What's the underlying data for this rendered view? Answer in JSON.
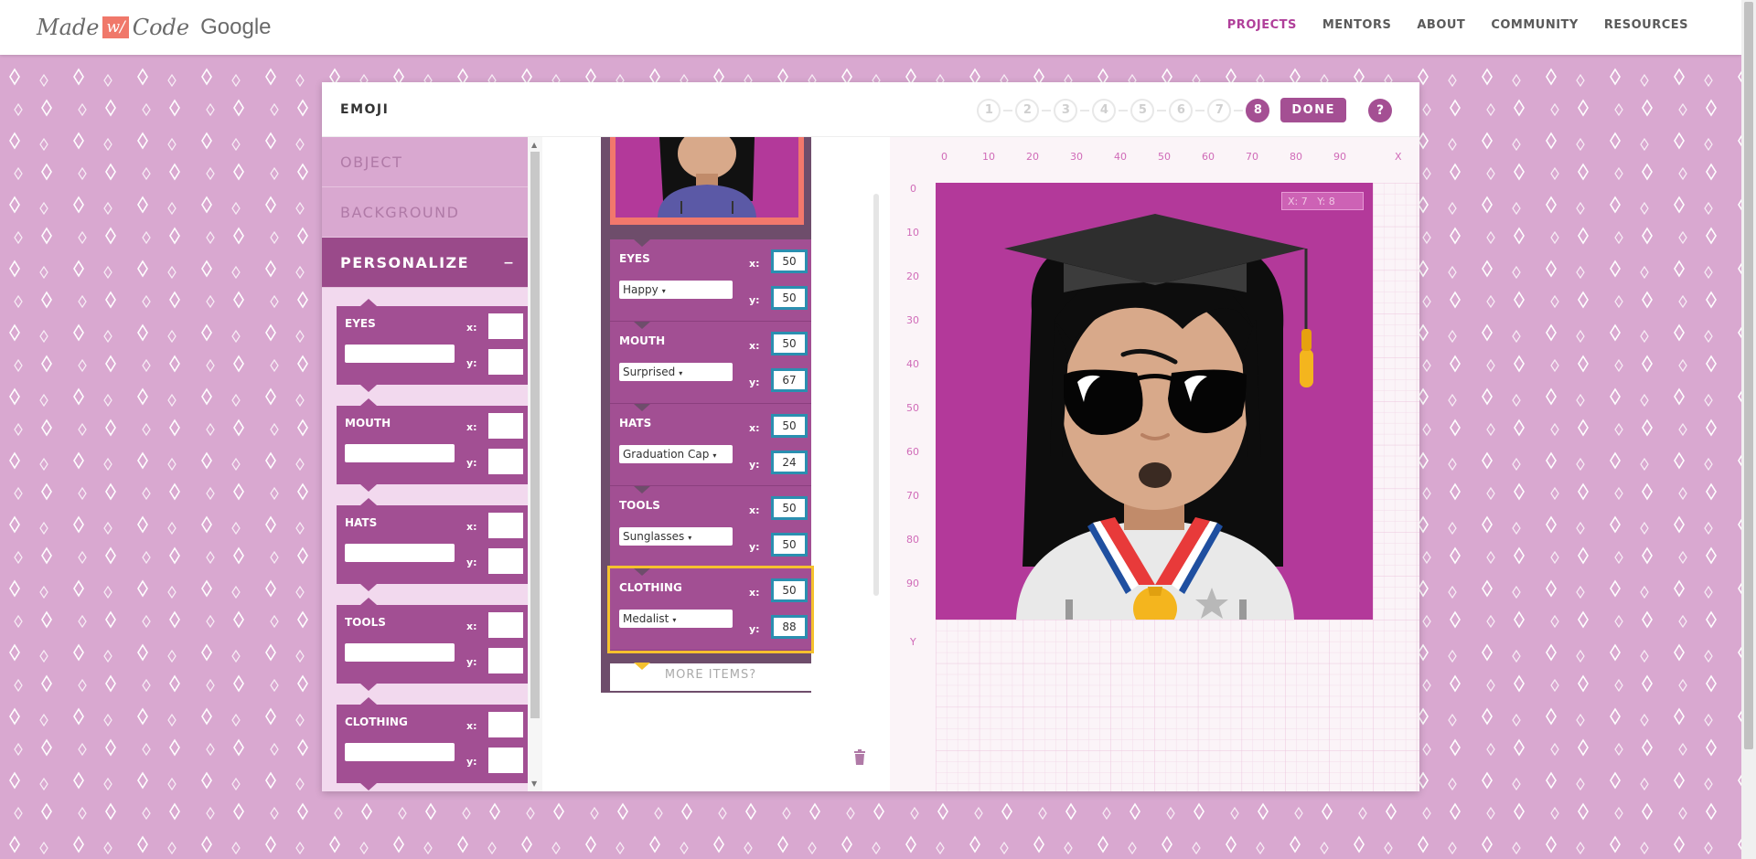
{
  "header": {
    "logo": {
      "made": "Made",
      "w": "w/",
      "code": "Code",
      "google": "Google"
    },
    "nav": [
      {
        "label": "PROJECTS",
        "active": true
      },
      {
        "label": "MENTORS",
        "active": false
      },
      {
        "label": "ABOUT",
        "active": false
      },
      {
        "label": "COMMUNITY",
        "active": false
      },
      {
        "label": "RESOURCES",
        "active": false
      }
    ]
  },
  "project": {
    "title": "EMOJI",
    "steps": [
      "1",
      "2",
      "3",
      "4",
      "5",
      "6",
      "7",
      "8"
    ],
    "current_step": 8,
    "done_label": "DONE",
    "help_label": "?"
  },
  "palette": {
    "categories": [
      {
        "label": "OBJECT",
        "open": false
      },
      {
        "label": "BACKGROUND",
        "open": false
      },
      {
        "label": "PERSONALIZE",
        "open": true,
        "toggle": "–"
      }
    ],
    "blocks": [
      {
        "name": "EYES",
        "x_label": "x:",
        "y_label": "y:"
      },
      {
        "name": "MOUTH",
        "x_label": "x:",
        "y_label": "y:"
      },
      {
        "name": "HATS",
        "x_label": "x:",
        "y_label": "y:"
      },
      {
        "name": "TOOLS",
        "x_label": "x:",
        "y_label": "y:"
      },
      {
        "name": "CLOTHING",
        "x_label": "x:",
        "y_label": "y:"
      }
    ]
  },
  "workspace": {
    "blocks": [
      {
        "name": "EYES",
        "selected_option": "Happy",
        "x": "50",
        "y": "50",
        "selected": false
      },
      {
        "name": "MOUTH",
        "selected_option": "Surprised",
        "x": "50",
        "y": "67",
        "selected": false
      },
      {
        "name": "HATS",
        "selected_option": "Graduation Cap",
        "x": "50",
        "y": "24",
        "selected": false
      },
      {
        "name": "TOOLS",
        "selected_option": "Sunglasses",
        "x": "50",
        "y": "50",
        "selected": false
      },
      {
        "name": "CLOTHING",
        "selected_option": "Medalist",
        "x": "50",
        "y": "88",
        "selected": true
      }
    ],
    "x_label": "x:",
    "y_label": "y:",
    "more_items": "MORE ITEMS?"
  },
  "canvas": {
    "x_ticks": [
      "0",
      "10",
      "20",
      "30",
      "40",
      "50",
      "60",
      "70",
      "80",
      "90"
    ],
    "x_axis_label": "X",
    "y_ticks": [
      "0",
      "10",
      "20",
      "30",
      "40",
      "50",
      "60",
      "70",
      "80",
      "90"
    ],
    "y_axis_label": "Y",
    "coord_x": "X: 7",
    "coord_y": "Y: 8",
    "background_color": "#b3399a"
  },
  "colors": {
    "accent": "#a44f93",
    "block": "#a24f93",
    "selected_outline": "#f5c12e",
    "page_bg": "#d9a8d0"
  }
}
